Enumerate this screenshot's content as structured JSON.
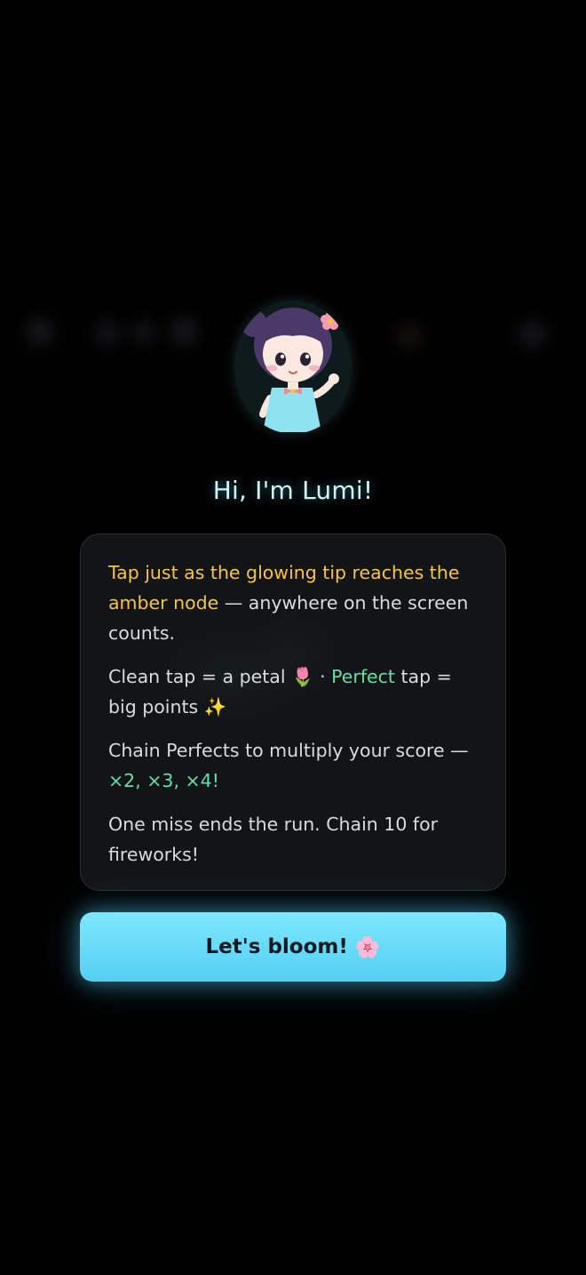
{
  "character": {
    "greeting": "Hi, I'm Lumi!"
  },
  "instructions": {
    "line1_highlight": "Tap just as the glowing tip reaches the amber node",
    "line1_rest": " — anywhere on the screen counts.",
    "line2_a": "Clean tap = a petal",
    "line2_a_icon": "🌷",
    "line2_sep": " · ",
    "line2_highlight": "Perfect",
    "line2_b": " tap = big points",
    "line2_b_icon": "✨",
    "line3_a": "Chain Perfects to multiply your score — ",
    "line3_multipliers": "×2, ×3, ×4!",
    "line4": "One miss ends the run. Chain 10 for fireworks!"
  },
  "start_button": {
    "label": "Let's bloom!",
    "icon": "🌸"
  },
  "colors": {
    "highlight_gold": "#f6c544",
    "highlight_green": "#63e0a5",
    "button_cyan": "#5fd6f5",
    "title_glow": "#cdf3fb"
  }
}
